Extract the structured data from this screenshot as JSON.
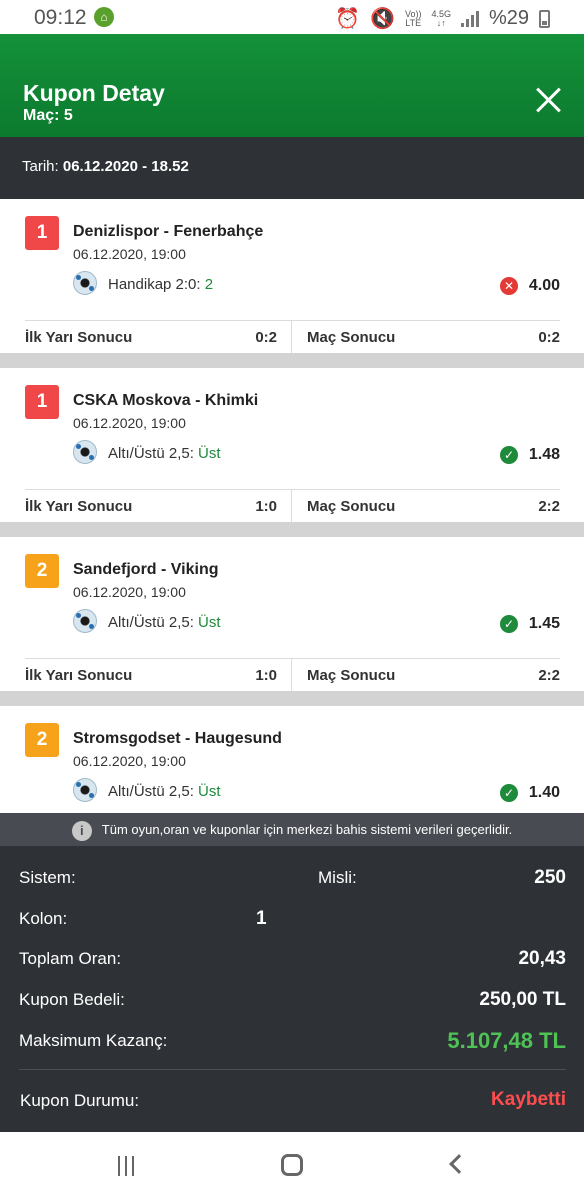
{
  "status_bar": {
    "time": "09:12",
    "network_top": "Vo))",
    "network_bottom": "LTE",
    "data_top": "4.5G",
    "data_bottom": "↓↑",
    "battery": "%29"
  },
  "header": {
    "title": "Kupon Detay",
    "subtitle": "Maç: 5"
  },
  "date_bar": {
    "label": "Tarih:",
    "value": "06.12.2020 - 18.52"
  },
  "matches": [
    {
      "badge": "1",
      "badge_color": "#f04848",
      "teams": "Denizlispor - Fenerbahçe",
      "date": "06.12.2020, 19:00",
      "bet_label": "Handikap 2:0:",
      "bet_pick": "2",
      "result": "lost",
      "odds": "4.00",
      "first_half_label": "İlk Yarı Sonucu",
      "first_half_score": "0:2",
      "full_time_label": "Maç Sonucu",
      "full_time_score": "0:2"
    },
    {
      "badge": "1",
      "badge_color": "#f04848",
      "teams": "CSKA Moskova - Khimki",
      "date": "06.12.2020, 19:00",
      "bet_label": "Altı/Üstü 2,5:",
      "bet_pick": "Üst",
      "result": "won",
      "odds": "1.48",
      "first_half_label": "İlk Yarı Sonucu",
      "first_half_score": "1:0",
      "full_time_label": "Maç Sonucu",
      "full_time_score": "2:2"
    },
    {
      "badge": "2",
      "badge_color": "#f7a21b",
      "teams": "Sandefjord - Viking",
      "date": "06.12.2020, 19:00",
      "bet_label": "Altı/Üstü 2,5:",
      "bet_pick": "Üst",
      "result": "won",
      "odds": "1.45",
      "first_half_label": "İlk Yarı Sonucu",
      "first_half_score": "1:0",
      "full_time_label": "Maç Sonucu",
      "full_time_score": "2:2"
    },
    {
      "badge": "2",
      "badge_color": "#f7a21b",
      "teams": "Stromsgodset - Haugesund",
      "date": "06.12.2020, 19:00",
      "bet_label": "Altı/Üstü 2,5:",
      "bet_pick": "Üst",
      "result": "won",
      "odds": "1.40"
    }
  ],
  "info_notice": "Tüm oyun,oran ve kuponlar için merkezi bahis sistemi verileri geçerlidir.",
  "summary": {
    "system_label": "Sistem:",
    "misli_label": "Misli:",
    "misli_value": "250",
    "kolon_label": "Kolon:",
    "kolon_value": "1",
    "total_odds_label": "Toplam Oran:",
    "total_odds_value": "20,43",
    "coupon_cost_label": "Kupon Bedeli:",
    "coupon_cost_value": "250,00 TL",
    "max_win_label": "Maksimum Kazanç:",
    "max_win_value": "5.107,48 TL",
    "coupon_status_label": "Kupon Durumu:",
    "coupon_status_value": "Kaybetti"
  },
  "colors": {
    "header_green": "#0c7a2e",
    "dark_panel": "#2e3237",
    "win_green": "#4fc255",
    "loss_red": "#ff4d4d"
  }
}
